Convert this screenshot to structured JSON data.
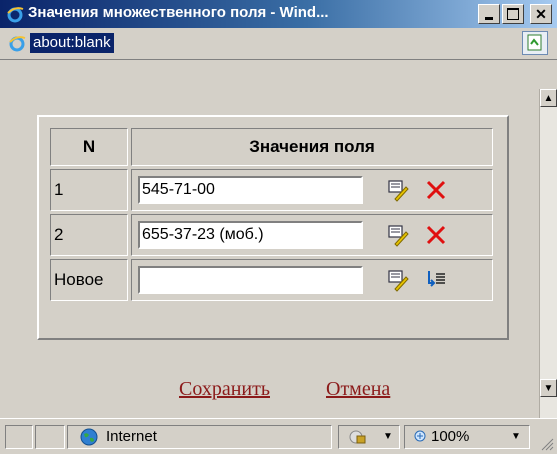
{
  "window": {
    "title": "Значения множественного поля - Wind...",
    "controls": {
      "minimize": "_",
      "maximize": "□",
      "close": "X"
    }
  },
  "address": {
    "url": "about:blank"
  },
  "table": {
    "header": {
      "num": "N",
      "values": "Значения поля"
    },
    "rows": [
      {
        "num": "1",
        "value": "545-71-00"
      },
      {
        "num": "2",
        "value": "655-37-23 (моб.)"
      },
      {
        "num": "Новое",
        "value": ""
      }
    ]
  },
  "actions": {
    "save": "Сохранить",
    "cancel": "Отмена"
  },
  "status": {
    "zone": "Internet",
    "zoom": "100%"
  }
}
